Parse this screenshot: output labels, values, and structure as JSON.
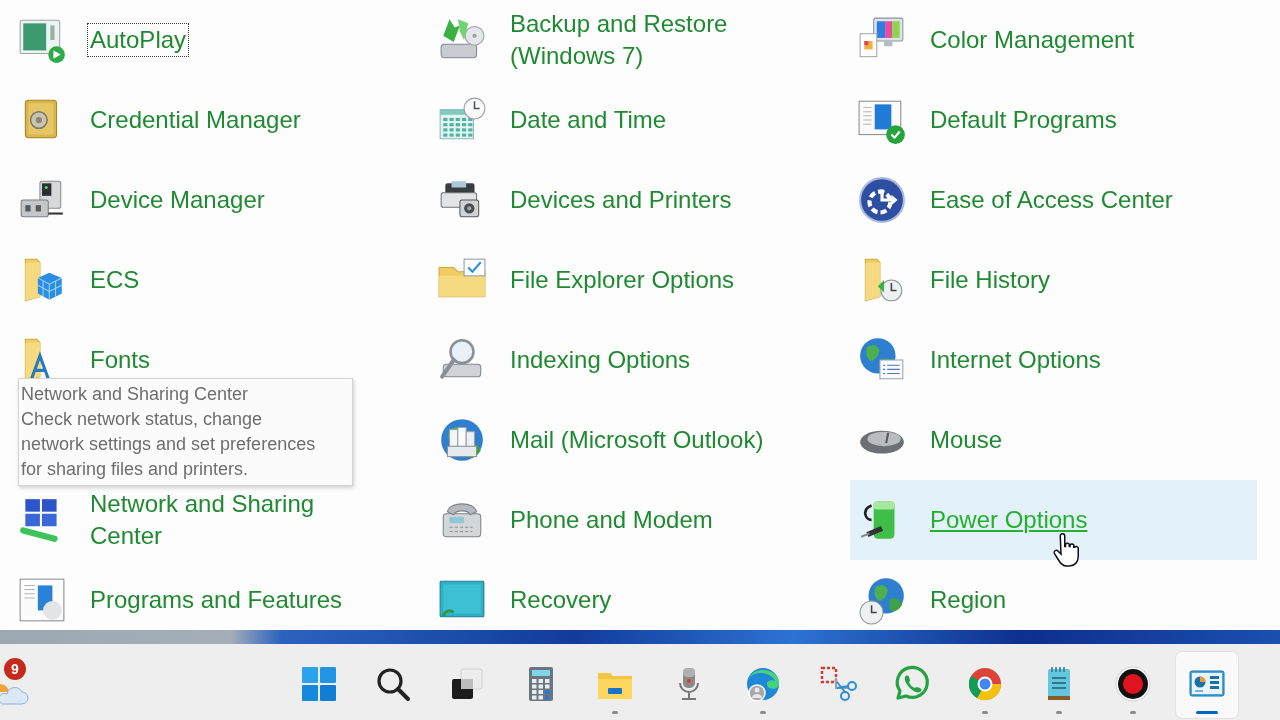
{
  "items": [
    {
      "kind": "link",
      "label": "AutoPlay",
      "focused": true,
      "hovered": false
    },
    {
      "kind": "link",
      "label": "Backup and Restore (Windows 7)",
      "focused": false,
      "hovered": false
    },
    {
      "kind": "link",
      "label": "Color Management",
      "focused": false,
      "hovered": false
    },
    {
      "kind": "link",
      "label": "Credential Manager",
      "focused": false,
      "hovered": false
    },
    {
      "kind": "link",
      "label": "Date and Time",
      "focused": false,
      "hovered": false
    },
    {
      "kind": "link",
      "label": "Default Programs",
      "focused": false,
      "hovered": false
    },
    {
      "kind": "link",
      "label": "Device Manager",
      "focused": false,
      "hovered": false
    },
    {
      "kind": "link",
      "label": "Devices and Printers",
      "focused": false,
      "hovered": false
    },
    {
      "kind": "link",
      "label": "Ease of Access Center",
      "focused": false,
      "hovered": false
    },
    {
      "kind": "link",
      "label": "ECS",
      "focused": false,
      "hovered": false
    },
    {
      "kind": "link",
      "label": "File Explorer Options",
      "focused": false,
      "hovered": false
    },
    {
      "kind": "link",
      "label": "File History",
      "focused": false,
      "hovered": false
    },
    {
      "kind": "link",
      "label": "Fonts",
      "focused": false,
      "hovered": false
    },
    {
      "kind": "link",
      "label": "Indexing Options",
      "focused": false,
      "hovered": false
    },
    {
      "kind": "link",
      "label": "Internet Options",
      "focused": false,
      "hovered": false
    },
    {
      "kind": "tooltip",
      "title": "Network and Sharing Center",
      "text": "Check network status, change network settings and set preferences for sharing files and printers."
    },
    {
      "kind": "link",
      "label": "Mail (Microsoft Outlook)",
      "focused": false,
      "hovered": false
    },
    {
      "kind": "link",
      "label": "Mouse",
      "focused": false,
      "hovered": false
    },
    {
      "kind": "link",
      "label": "Network and Sharing Center",
      "focused": false,
      "hovered": false
    },
    {
      "kind": "link",
      "label": "Phone and Modem",
      "focused": false,
      "hovered": false
    },
    {
      "kind": "link",
      "label": "Power Options",
      "focused": false,
      "hovered": true
    },
    {
      "kind": "link",
      "label": "Programs and Features",
      "focused": false,
      "hovered": false
    },
    {
      "kind": "link",
      "label": "Recovery",
      "focused": false,
      "hovered": false
    },
    {
      "kind": "link",
      "label": "Region",
      "focused": false,
      "hovered": false
    }
  ],
  "taskbar": {
    "notification_count": "9",
    "apps": [
      {
        "running": false,
        "selected": false
      },
      {
        "running": false,
        "selected": false
      },
      {
        "running": false,
        "selected": false
      },
      {
        "running": false,
        "selected": false
      },
      {
        "running": true,
        "selected": false
      },
      {
        "running": false,
        "selected": false
      },
      {
        "running": true,
        "selected": false
      },
      {
        "running": false,
        "selected": false
      },
      {
        "running": false,
        "selected": false
      },
      {
        "running": true,
        "selected": false
      },
      {
        "running": true,
        "selected": false
      },
      {
        "running": true,
        "selected": false
      },
      {
        "running": true,
        "selected": true
      }
    ]
  }
}
